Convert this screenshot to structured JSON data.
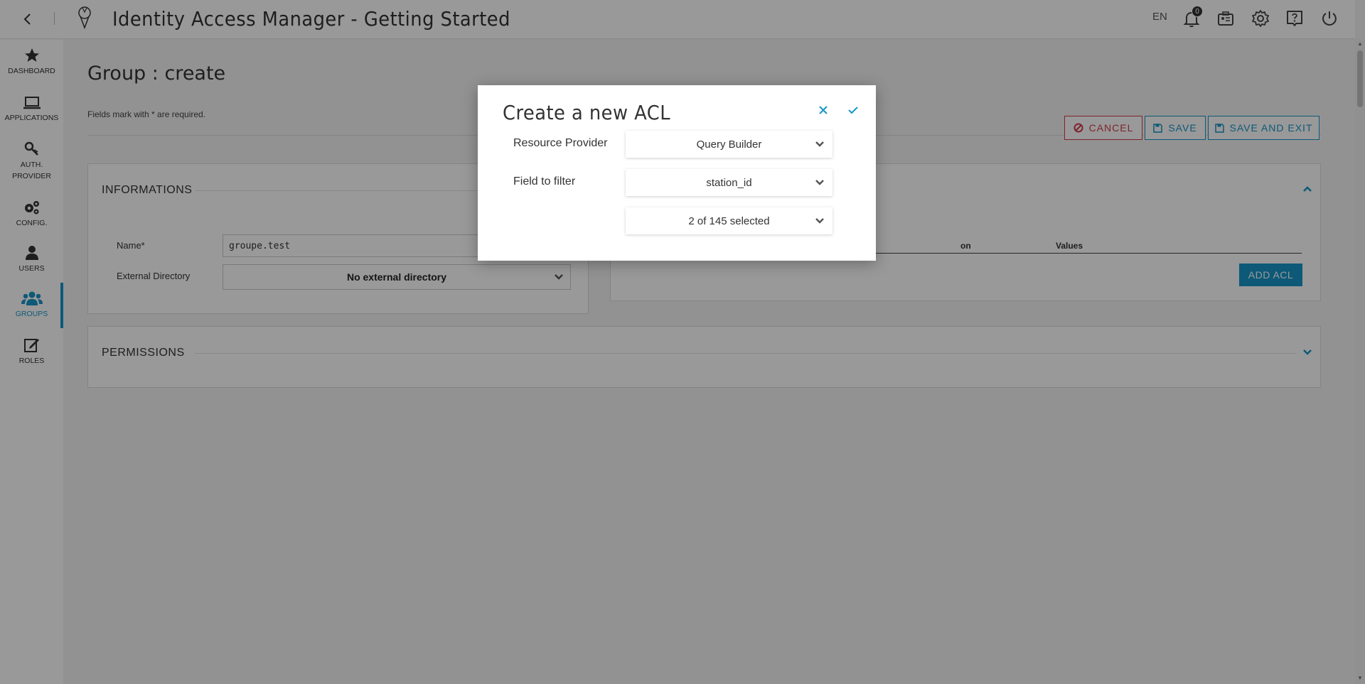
{
  "topbar": {
    "title": "Identity Access Manager - Getting Started",
    "lang": "EN",
    "notification_count": "0"
  },
  "sidebar": {
    "items": [
      {
        "label": "DASHBOARD",
        "icon": "star-icon"
      },
      {
        "label": "APPLICATIONS",
        "icon": "laptop-icon"
      },
      {
        "label": "AUTH. PROVIDER",
        "icon": "key-icon"
      },
      {
        "label": "CONFIG.",
        "icon": "gears-icon"
      },
      {
        "label": "USERS",
        "icon": "user-icon"
      },
      {
        "label": "GROUPS",
        "icon": "users-icon",
        "active": true
      },
      {
        "label": "ROLES",
        "icon": "edit-icon"
      }
    ]
  },
  "page": {
    "title": "Group : create",
    "required_note": "Fields mark with * are required."
  },
  "actions": {
    "cancel": "CANCEL",
    "save": "SAVE",
    "save_and_exit": "SAVE AND EXIT"
  },
  "informations": {
    "title": "INFORMATIONS",
    "name_label": "Name*",
    "name_value": "groupe.test",
    "external_directory_label": "External Directory",
    "external_directory_value": "No external directory"
  },
  "acl_panel": {
    "columns": [
      "on",
      "Values"
    ],
    "add_button": "ADD ACL"
  },
  "permissions": {
    "title": "PERMISSIONS"
  },
  "modal": {
    "title": "Create a new ACL",
    "resource_provider_label": "Resource Provider",
    "resource_provider_value": "Query Builder",
    "field_label": "Field to filter",
    "field_value": "station_id",
    "values_selection": "2 of 145 selected"
  },
  "colors": {
    "accent": "#1795c7",
    "danger": "#d43b4b"
  }
}
